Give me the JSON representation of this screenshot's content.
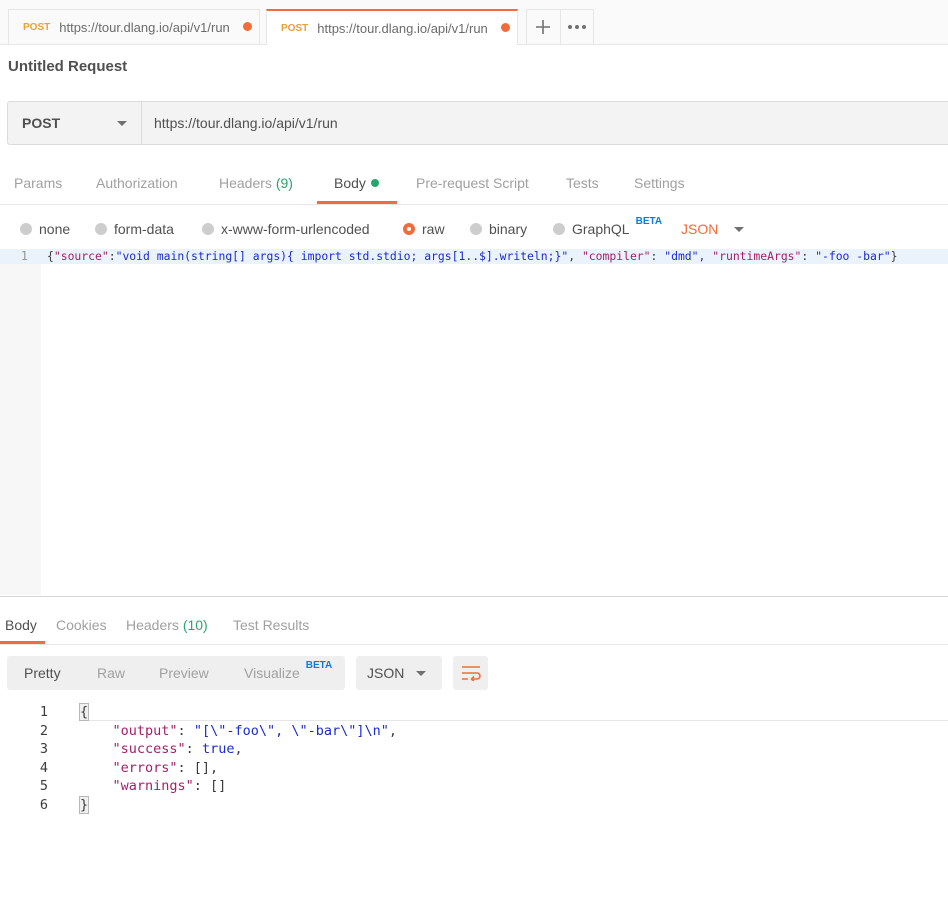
{
  "tabs": [
    {
      "method": "POST",
      "url": "https://tour.dlang.io/api/v1/run",
      "active": false
    },
    {
      "method": "POST",
      "url": "https://tour.dlang.io/api/v1/run",
      "active": true
    }
  ],
  "request_title": "Untitled Request",
  "request": {
    "method": "POST",
    "url": "https://tour.dlang.io/api/v1/run"
  },
  "request_tabs": {
    "params": "Params",
    "authorization": "Authorization",
    "headers": "Headers",
    "headers_count": "(9)",
    "body": "Body",
    "pre_request": "Pre-request Script",
    "tests": "Tests",
    "settings": "Settings"
  },
  "body_types": {
    "none": "none",
    "form_data": "form-data",
    "urlencoded": "x-www-form-urlencoded",
    "raw": "raw",
    "binary": "binary",
    "graphql": "GraphQL",
    "graphql_badge": "BETA",
    "selected": "raw",
    "language": "JSON"
  },
  "editor": {
    "line_number": "1",
    "tokens": [
      {
        "t": "{",
        "c": "p"
      },
      {
        "t": "\"source\"",
        "c": "k"
      },
      {
        "t": ":",
        "c": "p"
      },
      {
        "t": "\"void main(string[] args){ import std.stdio; args[1..$].writeln;}\"",
        "c": "s"
      },
      {
        "t": ", ",
        "c": "p"
      },
      {
        "t": "\"compiler\"",
        "c": "k"
      },
      {
        "t": ": ",
        "c": "p"
      },
      {
        "t": "\"dmd\"",
        "c": "s"
      },
      {
        "t": ", ",
        "c": "p"
      },
      {
        "t": "\"runtimeArgs\"",
        "c": "k"
      },
      {
        "t": ": ",
        "c": "p"
      },
      {
        "t": "\"-foo -bar\"",
        "c": "s"
      },
      {
        "t": "}",
        "c": "p"
      }
    ]
  },
  "response_tabs": {
    "body": "Body",
    "cookies": "Cookies",
    "headers": "Headers",
    "headers_count": "(10)",
    "test_results": "Test Results"
  },
  "response_view": {
    "pretty": "Pretty",
    "raw": "Raw",
    "preview": "Preview",
    "visualize": "Visualize",
    "visualize_badge": "BETA",
    "format": "JSON"
  },
  "response_lines": [
    {
      "n": "1",
      "tokens": [
        {
          "t": "{",
          "c": "brace"
        }
      ]
    },
    {
      "n": "2",
      "tokens": [
        {
          "t": "    ",
          "c": "p"
        },
        {
          "t": "\"output\"",
          "c": "k"
        },
        {
          "t": ": ",
          "c": "p"
        },
        {
          "t": "\"[\\\"-foo\\\", \\\"-bar\\\"]\\n\"",
          "c": "s"
        },
        {
          "t": ",",
          "c": "p"
        }
      ]
    },
    {
      "n": "3",
      "tokens": [
        {
          "t": "    ",
          "c": "p"
        },
        {
          "t": "\"success\"",
          "c": "k"
        },
        {
          "t": ": ",
          "c": "p"
        },
        {
          "t": "true",
          "c": "s"
        },
        {
          "t": ",",
          "c": "p"
        }
      ]
    },
    {
      "n": "4",
      "tokens": [
        {
          "t": "    ",
          "c": "p"
        },
        {
          "t": "\"errors\"",
          "c": "k"
        },
        {
          "t": ": [],",
          "c": "p"
        }
      ]
    },
    {
      "n": "5",
      "tokens": [
        {
          "t": "    ",
          "c": "p"
        },
        {
          "t": "\"warnings\"",
          "c": "k"
        },
        {
          "t": ": []",
          "c": "p"
        }
      ]
    },
    {
      "n": "6",
      "tokens": [
        {
          "t": "}",
          "c": "brace"
        }
      ]
    }
  ],
  "colors": {
    "accent": "#f26b3a",
    "method": "#e8a135",
    "green": "#26a66b",
    "json_key": "#a2206a",
    "json_string": "#1b2bd0",
    "beta": "#0d7cd9"
  }
}
